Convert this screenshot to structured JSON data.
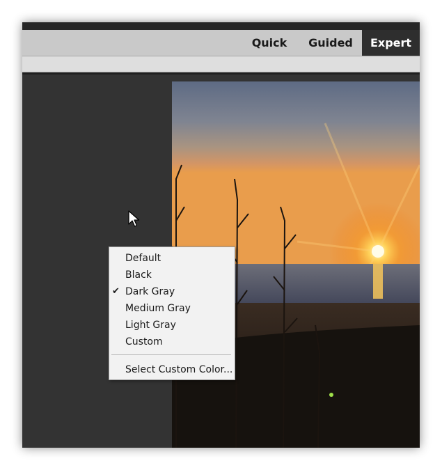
{
  "mode_tabs": {
    "quick": "Quick",
    "guided": "Guided",
    "expert": "Expert",
    "active": "Expert"
  },
  "context_menu": {
    "items": [
      {
        "label": "Default",
        "checked": false
      },
      {
        "label": "Black",
        "checked": false
      },
      {
        "label": "Dark Gray",
        "checked": true
      },
      {
        "label": "Medium Gray",
        "checked": false
      },
      {
        "label": "Light Gray",
        "checked": false
      },
      {
        "label": "Custom",
        "checked": false
      }
    ],
    "select_custom": "Select Custom Color...",
    "check_glyph": "✔"
  },
  "colors": {
    "canvas_background": "#333333",
    "mode_bar": "#c9c9c9",
    "active_tab": "#2e2e2e",
    "menu_background": "#f2f2f2"
  },
  "icons": {
    "cursor": "mouse-pointer-icon",
    "check": "checkmark-icon"
  }
}
